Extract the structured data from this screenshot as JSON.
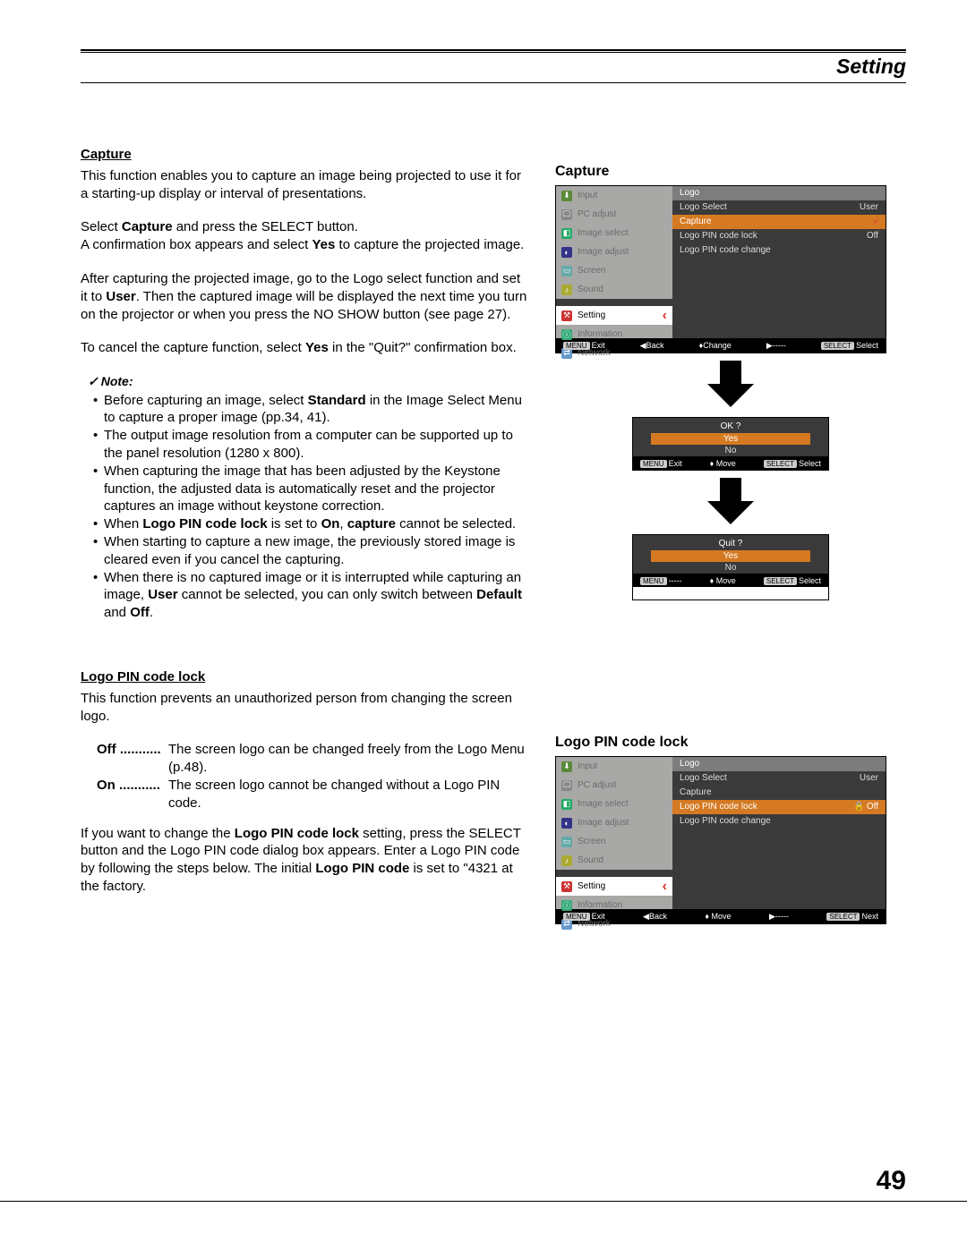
{
  "header": {
    "title": "Setting"
  },
  "pageNumber": "49",
  "capture": {
    "title": "Capture",
    "p1": "This function enables you to capture an image being projected to use it for a starting-up display or interval of presentations.",
    "p2a": "Select ",
    "p2b": "Capture",
    "p2c": " and press the SELECT button.",
    "p3a": "A confirmation box appears and select ",
    "p3b": "Yes",
    "p3c": " to capture the projected image.",
    "p4a": "After capturing the projected image, go to the Logo select function and set it to ",
    "p4b": "User",
    "p4c": ". Then the captured image will be displayed the next time you turn on the projector or when you press the NO SHOW button (see page 27).",
    "p5a": "To cancel the capture function, select ",
    "p5b": "Yes",
    "p5c": " in the \"Quit?\" confirmation box.",
    "noteHead": "Note:",
    "notes": {
      "n1a": "Before capturing an image, select ",
      "n1b": "Standard",
      "n1c": " in the Image Select Menu to capture a proper image (pp.34, 41).",
      "n2": "The output image resolution from a computer can be supported up to the panel resolution (1280 x 800).",
      "n3": "When capturing the image that has been adjusted by the Keystone function, the adjusted data is automatically reset and the projector captures an image without keystone correction.",
      "n4a": "When ",
      "n4b": "Logo PIN code lock",
      "n4c": " is set to ",
      "n4d": "On",
      "n4e": ", ",
      "n4f": "capture",
      "n4g": " cannot be selected.",
      "n5": "When starting to capture a new image, the previously stored image is cleared even if you cancel the capturing.",
      "n6a": "When there is no captured image or it is interrupted while capturing an image, ",
      "n6b": "User",
      "n6c": " cannot be selected, you can only switch between ",
      "n6d": "Default",
      "n6e": " and ",
      "n6f": "Off",
      "n6g": "."
    }
  },
  "logoPin": {
    "title": "Logo PIN code lock",
    "p1": "This function prevents an unauthorized person from changing the screen logo.",
    "defs": {
      "offTerm": "Off",
      "offDesc": "The screen logo can be changed freely from the Logo Menu (p.48).",
      "onTerm": "On",
      "onDesc": "The screen logo cannot be changed without a Logo PIN code."
    },
    "p2a": "If you want to change the ",
    "p2b": "Logo PIN code lock",
    "p2c": " setting, press the SELECT button and the Logo PIN code dialog box appears. Enter a Logo PIN code by following the steps below. The initial ",
    "p2d": "Logo PIN code",
    "p2e": " is set to \"4321 at the factory."
  },
  "osd": {
    "captureTitle": "Capture",
    "logoPinTitle": "Logo PIN code lock",
    "leftMenu": [
      "Input",
      "PC adjust",
      "Image select",
      "Image adjust",
      "Screen",
      "Sound",
      "Setting",
      "Information",
      "Network"
    ],
    "rightHeader": "Logo",
    "rows1": [
      {
        "l": "Logo Select",
        "r": "User",
        "sel": false
      },
      {
        "l": "Capture",
        "r": "",
        "sel": true
      },
      {
        "l": "Logo PIN code lock",
        "r": "Off",
        "sel": false
      },
      {
        "l": "Logo PIN code change",
        "r": "",
        "sel": false
      }
    ],
    "rows2": [
      {
        "l": "Logo Select",
        "r": "User",
        "sel": false
      },
      {
        "l": "Capture",
        "r": "",
        "sel": false
      },
      {
        "l": "Logo PIN code lock",
        "r": "Off",
        "sel": true
      },
      {
        "l": "Logo PIN code change",
        "r": "",
        "sel": false
      }
    ],
    "bar1": {
      "a": "Exit",
      "b": "Back",
      "c": "Change",
      "d": "-----",
      "e": "Select"
    },
    "bar2": {
      "a": "Exit",
      "b": "Back",
      "c": "Move",
      "d": "-----",
      "e": "Next"
    },
    "ok": {
      "q": "OK ?",
      "yes": "Yes",
      "no": "No",
      "exit": "Exit",
      "move": "Move",
      "select": "Select"
    },
    "quit": {
      "q": "Quit ?",
      "yes": "Yes",
      "no": "No",
      "dash": "-----",
      "move": "Move",
      "select": "Select"
    }
  }
}
